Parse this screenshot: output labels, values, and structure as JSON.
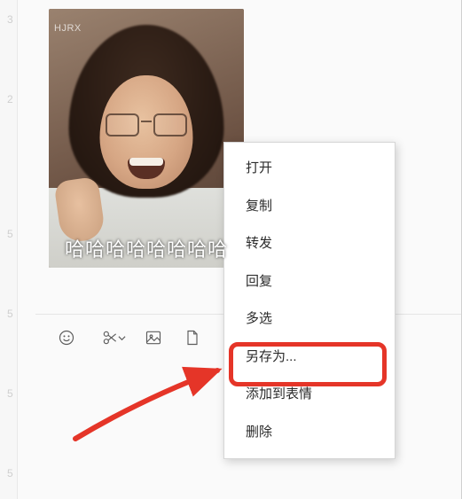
{
  "image": {
    "watermark": "HJRX",
    "caption": "哈哈哈哈哈哈哈哈"
  },
  "toolbar": {
    "emoji": "emoji",
    "scissors": "scissors",
    "image": "image",
    "file": "file"
  },
  "menu": {
    "open": "打开",
    "copy": "复制",
    "forward": "转发",
    "reply": "回复",
    "multiselect": "多选",
    "saveas": "另存为...",
    "addsticker": "添加到表情",
    "delete": "删除"
  },
  "ticks": [
    "3",
    "2",
    "5",
    "5",
    "5",
    "5"
  ]
}
